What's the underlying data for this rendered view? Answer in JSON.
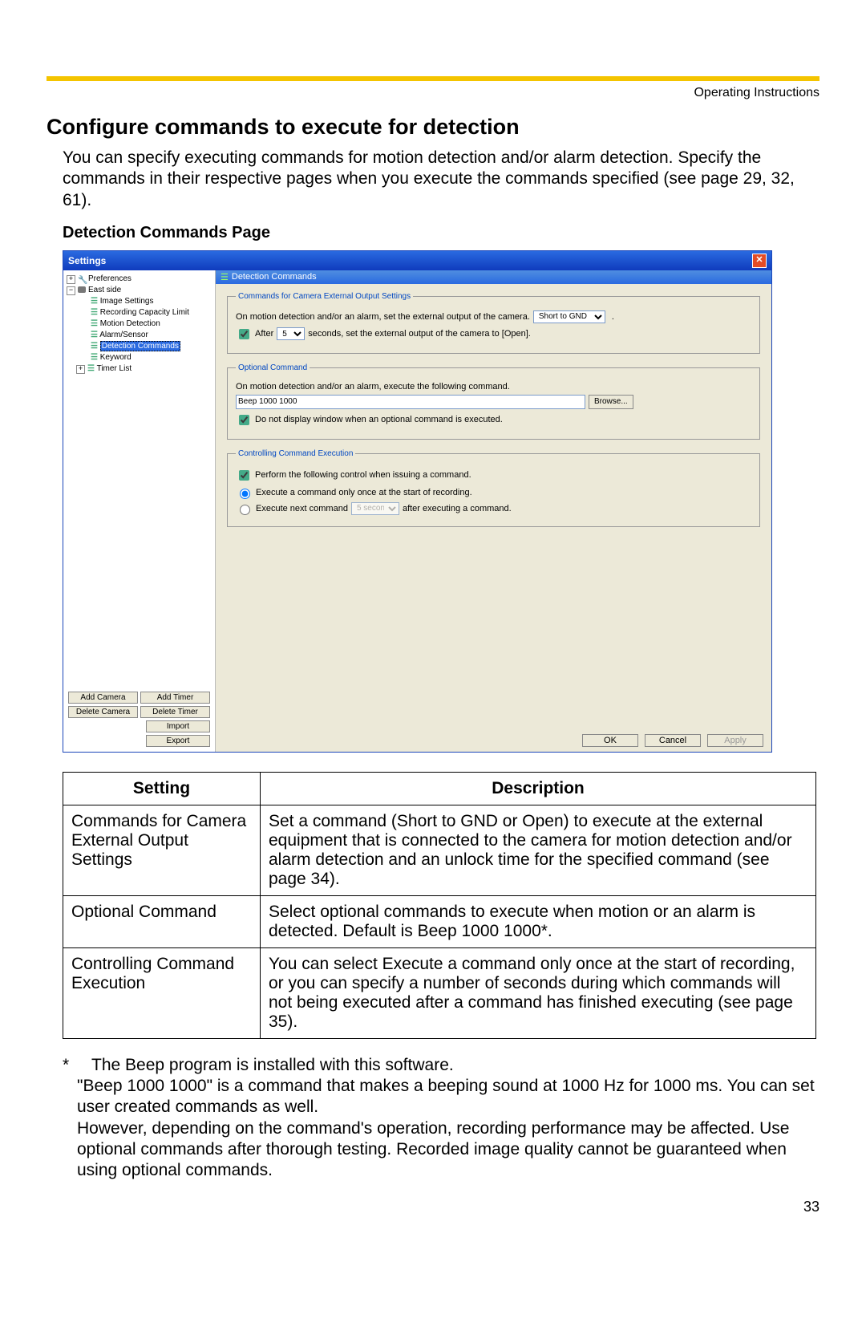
{
  "header": {
    "right": "Operating Instructions"
  },
  "title": "Configure commands to execute for detection",
  "intro": "You can specify executing commands for motion detection and/or alarm detection. Specify the commands in their respective pages when you execute the commands specified (see page 29, 32, 61).",
  "subheading": "Detection Commands Page",
  "dialog": {
    "title": "Settings",
    "crumb": "Detection Commands",
    "tree": {
      "preferences": "Preferences",
      "eastside": "East side",
      "items": [
        "Image Settings",
        "Recording Capacity Limit",
        "Motion Detection",
        "Alarm/Sensor",
        "Detection Commands",
        "Keyword",
        "Timer List"
      ]
    },
    "group1": {
      "legend": "Commands for Camera External Output Settings",
      "line1_pre": "On motion detection and/or an alarm, set the external output of the camera.",
      "select1_value": "Short to GND",
      "after_label": "After",
      "after_value": "5",
      "line2_post": "seconds, set the external output of the camera to [Open]."
    },
    "group2": {
      "legend": "Optional Command",
      "line1": "On motion detection and/or an alarm, execute the following command.",
      "cmd_value": "Beep 1000 1000",
      "browse": "Browse...",
      "chk_label": "Do not display window when an optional command is executed."
    },
    "group3": {
      "legend": "Controlling Command Execution",
      "chk_label": "Perform the following control when issuing a command.",
      "radio1": "Execute a command only once at the start of recording.",
      "radio2_pre": "Execute next command",
      "radio2_value": "5 second",
      "radio2_post": "after executing a command."
    },
    "left_buttons": {
      "add_camera": "Add Camera",
      "add_timer": "Add Timer",
      "delete_camera": "Delete Camera",
      "delete_timer": "Delete Timer",
      "import": "Import",
      "export": "Export"
    },
    "footer": {
      "ok": "OK",
      "cancel": "Cancel",
      "apply": "Apply"
    }
  },
  "table": {
    "hdr_setting": "Setting",
    "hdr_desc": "Description",
    "rows": [
      {
        "s": "Commands for Camera External Output Settings",
        "d": "Set a command (Short to GND or Open) to execute at the external equipment that is connected to the camera for motion detection and/or alarm detection and an unlock time for the specified command (see page 34)."
      },
      {
        "s": "Optional Command",
        "d": "Select optional commands to execute when motion or an alarm is detected. Default is Beep 1000 1000*."
      },
      {
        "s": "Controlling Command Execution",
        "d": "You can select Execute a command only once at the start of recording, or you can specify a number of seconds during which commands will not being executed after a command has finished executing (see page 35)."
      }
    ]
  },
  "footnote": "The Beep program is installed with this software.\n\"Beep 1000 1000\" is a command that makes a beeping sound at 1000 Hz for 1000 ms. You can set user created commands as well.\nHowever, depending on the command's operation, recording performance may be affected. Use optional commands after thorough testing. Recorded image quality cannot be guaranteed when using optional commands.",
  "page_number": "33"
}
